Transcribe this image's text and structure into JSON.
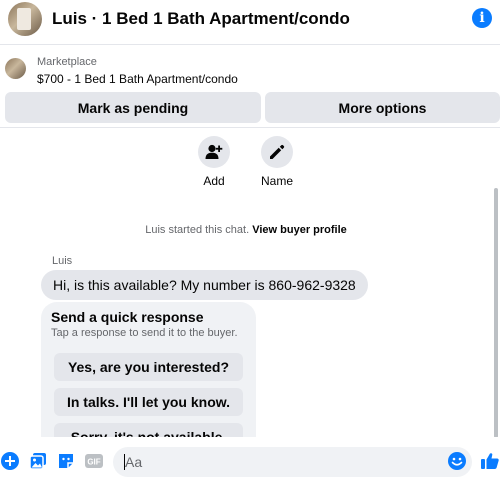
{
  "header": {
    "title": "Luis · 1 Bed 1 Bath Apartment/condo",
    "avatar_icon": "apartment-photo-avatar",
    "info_icon": "info-icon",
    "info_glyph": "i"
  },
  "listing": {
    "source": "Marketplace",
    "title": "$700 - 1 Bed 1 Bath Apartment/condo"
  },
  "actions": {
    "pending_label": "Mark as pending",
    "more_label": "More options"
  },
  "quick_actions": [
    {
      "label": "Add",
      "icon": "add-person-icon"
    },
    {
      "label": "Name",
      "icon": "pencil-icon"
    }
  ],
  "chat": {
    "system_prefix": "Luis started this chat.",
    "system_link": "View buyer profile",
    "sender": "Luis",
    "message": "Hi, is this available? My number is 860-962-9328",
    "quick_response": {
      "title": "Send a quick response",
      "subtitle": "Tap a response to send it to the buyer.",
      "options": [
        "Yes, are you interested?",
        "In talks. I'll let you know.",
        "Sorry, it's not available."
      ]
    }
  },
  "composer": {
    "placeholder": "Aa",
    "gif_label": "GIF"
  },
  "colors": {
    "accent": "#0a7cff",
    "bubble": "#e4e6eb",
    "secondary_text": "#65676b"
  }
}
